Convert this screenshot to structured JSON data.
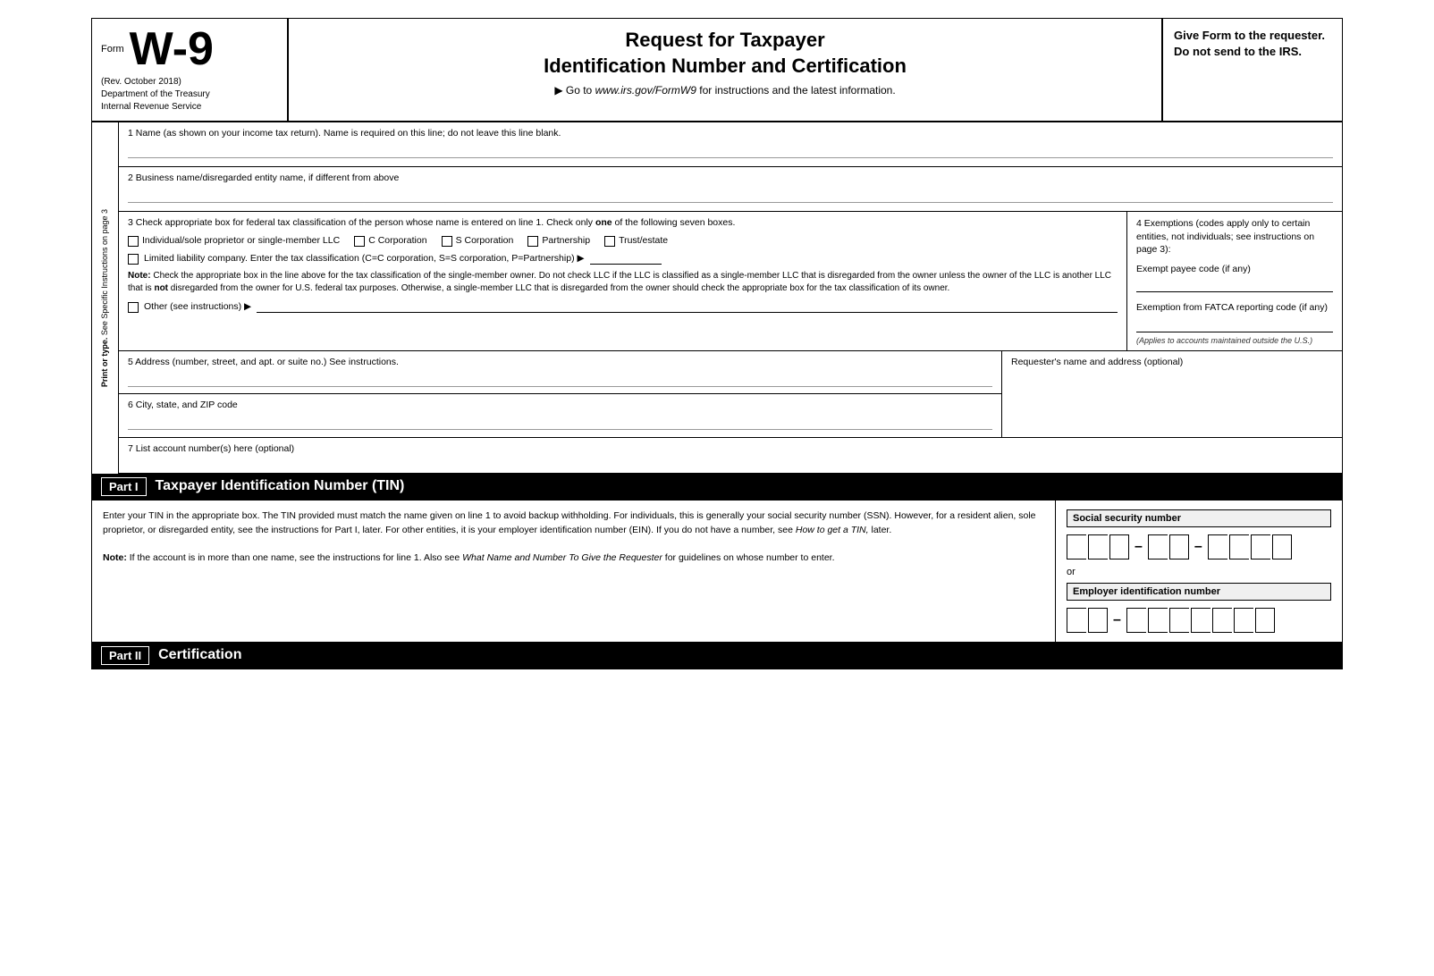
{
  "header": {
    "form_label": "Form",
    "form_number": "W-9",
    "rev_date": "(Rev. October 2018)",
    "dept1": "Department of the Treasury",
    "dept2": "Internal Revenue Service",
    "main_title_line1": "Request for Taxpayer",
    "main_title_line2": "Identification Number and Certification",
    "goto_text": "Go to ",
    "goto_url": "www.irs.gov/FormW9",
    "goto_suffix": " for instructions and the latest information.",
    "right_text": "Give Form to the requester. Do not send to the IRS."
  },
  "side_label": {
    "line1": "Print or type.",
    "line2": "See Specific Instructions on page 3"
  },
  "field1": {
    "label": "1 Name (as shown on your income tax return). Name is required on this line; do not leave this line blank."
  },
  "field2": {
    "label": "2 Business name/disregarded entity name, if different from above"
  },
  "field3": {
    "label_start": "3 Check appropriate box for federal tax classification of the person whose name is entered on line 1. Check only ",
    "label_bold": "one",
    "label_end": " of the following seven boxes.",
    "individual_label": "Individual/sole proprietor or single-member LLC",
    "c_corp_label": "C Corporation",
    "s_corp_label": "S Corporation",
    "partnership_label": "Partnership",
    "trust_label": "Trust/estate",
    "llc_label": "Limited liability company. Enter the tax classification (C=C corporation, S=S corporation, P=Partnership) ▶",
    "note_bold": "Note:",
    "note_text": " Check the appropriate box in the line above for the tax classification of the single-member owner. Do not check LLC if the LLC is classified as a single-member LLC that is disregarded from the owner unless the owner of the LLC is another LLC that is ",
    "note_not": "not",
    "note_text2": " disregarded from the owner for U.S. federal tax purposes. Otherwise, a single-member LLC that is disregarded from the owner should check the appropriate box for the tax classification of its owner.",
    "other_label": "Other (see instructions) ▶"
  },
  "field4": {
    "title": "4 Exemptions (codes apply only to certain entities, not individuals; see instructions on page 3):",
    "exempt_label": "Exempt payee code (if any)",
    "fatca_label": "Exemption from FATCA reporting code (if any)",
    "applies_text": "(Applies to accounts maintained outside the U.S.)"
  },
  "field5": {
    "label": "5 Address (number, street, and apt. or suite no.) See instructions.",
    "requester_label": "Requester's name and address (optional)"
  },
  "field6": {
    "label": "6 City, state, and ZIP code"
  },
  "field7": {
    "label": "7 List account number(s) here (optional)"
  },
  "part1": {
    "label": "Part I",
    "title": "Taxpayer Identification Number (TIN)",
    "body_text": "Enter your TIN in the appropriate box. The TIN provided must match the name given on line 1 to avoid backup withholding. For individuals, this is generally your social security number (SSN). However, for a resident alien, sole proprietor, or disregarded entity, see the instructions for Part I, later. For other entities, it is your employer identification number (EIN). If you do not have a number, see ",
    "body_italic": "How to get a TIN,",
    "body_text2": " later.",
    "note_bold": "Note:",
    "note_text": " If the account is in more than one name, see the instructions for line 1. Also see ",
    "note_italic": "What Name and Number To Give the Requester",
    "note_text2": " for guidelines on whose number to enter.",
    "ssn_label": "Social security number",
    "or_text": "or",
    "ein_label": "Employer identification number"
  },
  "part2": {
    "label": "Part II",
    "title": "Certification"
  }
}
